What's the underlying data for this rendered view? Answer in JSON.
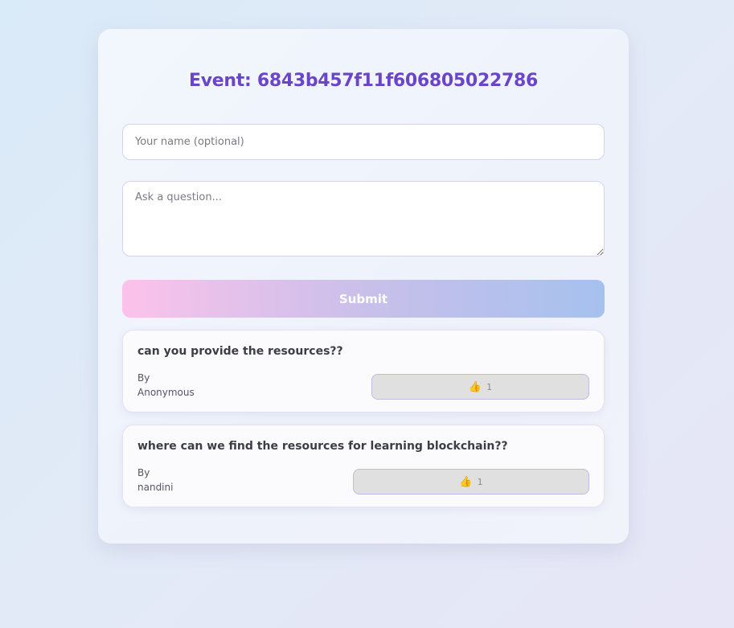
{
  "page": {
    "title": "Event: 6843b457f11f606805022786"
  },
  "form": {
    "name_placeholder": "Your name (optional)",
    "question_placeholder": "Ask a question...",
    "submit_label": "Submit"
  },
  "questions": [
    {
      "text": "can you provide the resources??",
      "by_label": "By",
      "author": "Anonymous",
      "like_icon": "thumbs-up-icon",
      "likes": "1"
    },
    {
      "text": "where can we find the resources for learning blockchain??",
      "by_label": "By",
      "author": "nandini",
      "like_icon": "thumbs-up-icon",
      "likes": "1"
    }
  ],
  "colors": {
    "title": "#6a45c9",
    "submit_gradient_start": "#fbc2eb",
    "submit_gradient_end": "#a6c1ee",
    "like_button_bg": "#e0e0e0"
  }
}
